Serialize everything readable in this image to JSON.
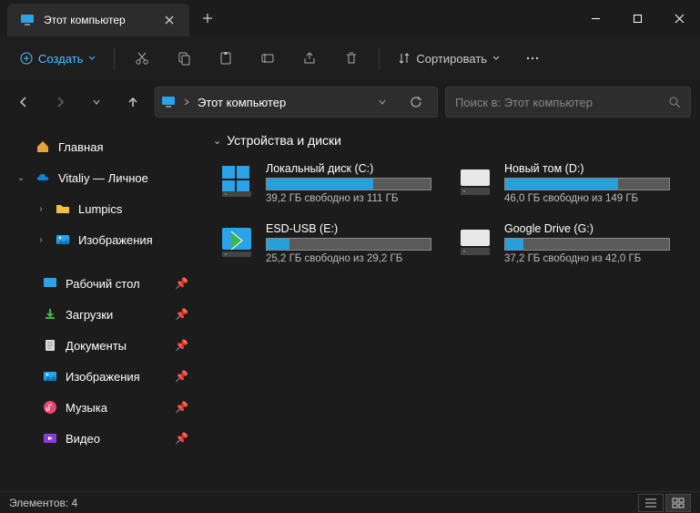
{
  "tab": {
    "title": "Этот компьютер"
  },
  "toolbar": {
    "create": "Создать",
    "sort": "Сортировать"
  },
  "addressbar": {
    "path": "Этот компьютер"
  },
  "search": {
    "placeholder": "Поиск в: Этот компьютер"
  },
  "sidebar": {
    "home": "Главная",
    "onedrive": "Vitaliy — Личное",
    "lumpics": "Lumpics",
    "images": "Изображения",
    "desktop": "Рабочий стол",
    "downloads": "Загрузки",
    "documents": "Документы",
    "pictures": "Изображения",
    "music": "Музыка",
    "videos": "Видео"
  },
  "section": {
    "title": "Устройства и диски"
  },
  "drives": [
    {
      "name": "Локальный диск (C:)",
      "info": "39,2 ГБ свободно из 111 ГБ",
      "used_pct": 65,
      "icon": "windows"
    },
    {
      "name": "Новый том (D:)",
      "info": "46,0 ГБ свободно из 149 ГБ",
      "used_pct": 69,
      "icon": "hdd"
    },
    {
      "name": "ESD-USB (E:)",
      "info": "25,2 ГБ свободно из 29,2 ГБ",
      "used_pct": 14,
      "icon": "usb"
    },
    {
      "name": "Google Drive (G:)",
      "info": "37,2 ГБ свободно из 42,0 ГБ",
      "used_pct": 11,
      "icon": "hdd"
    }
  ],
  "status": {
    "count_label": "Элементов: 4"
  }
}
